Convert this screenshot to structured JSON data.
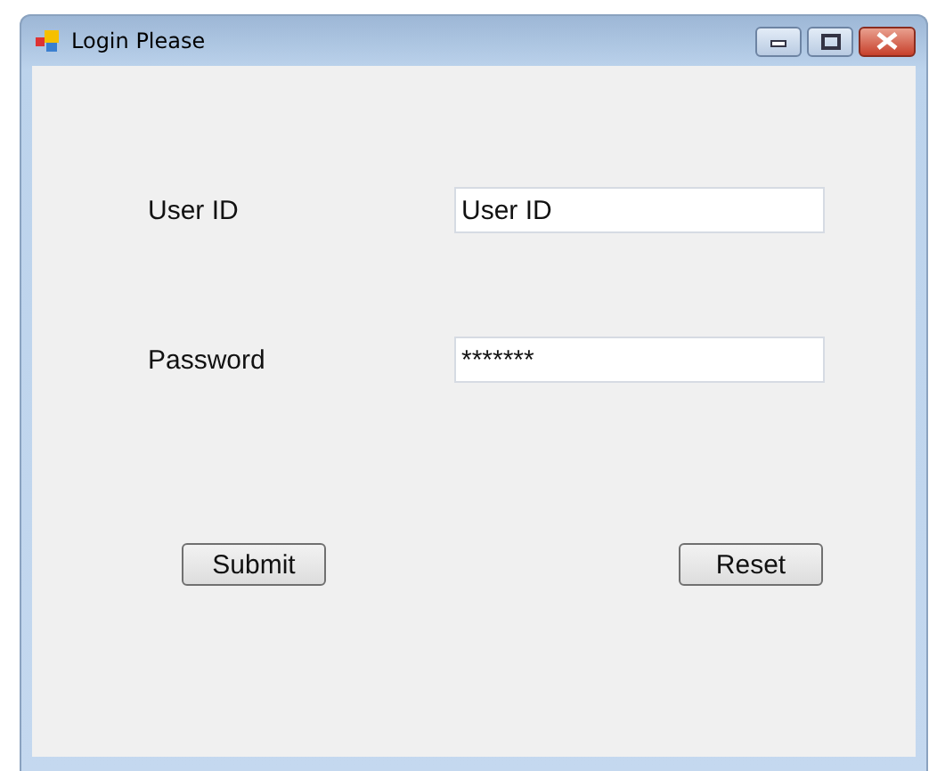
{
  "window": {
    "title": "Login Please"
  },
  "fields": [
    {
      "label": "User ID",
      "value": "User ID"
    },
    {
      "label": "Password",
      "value": "*******"
    }
  ],
  "buttons": [
    "Submit",
    "Reset"
  ]
}
